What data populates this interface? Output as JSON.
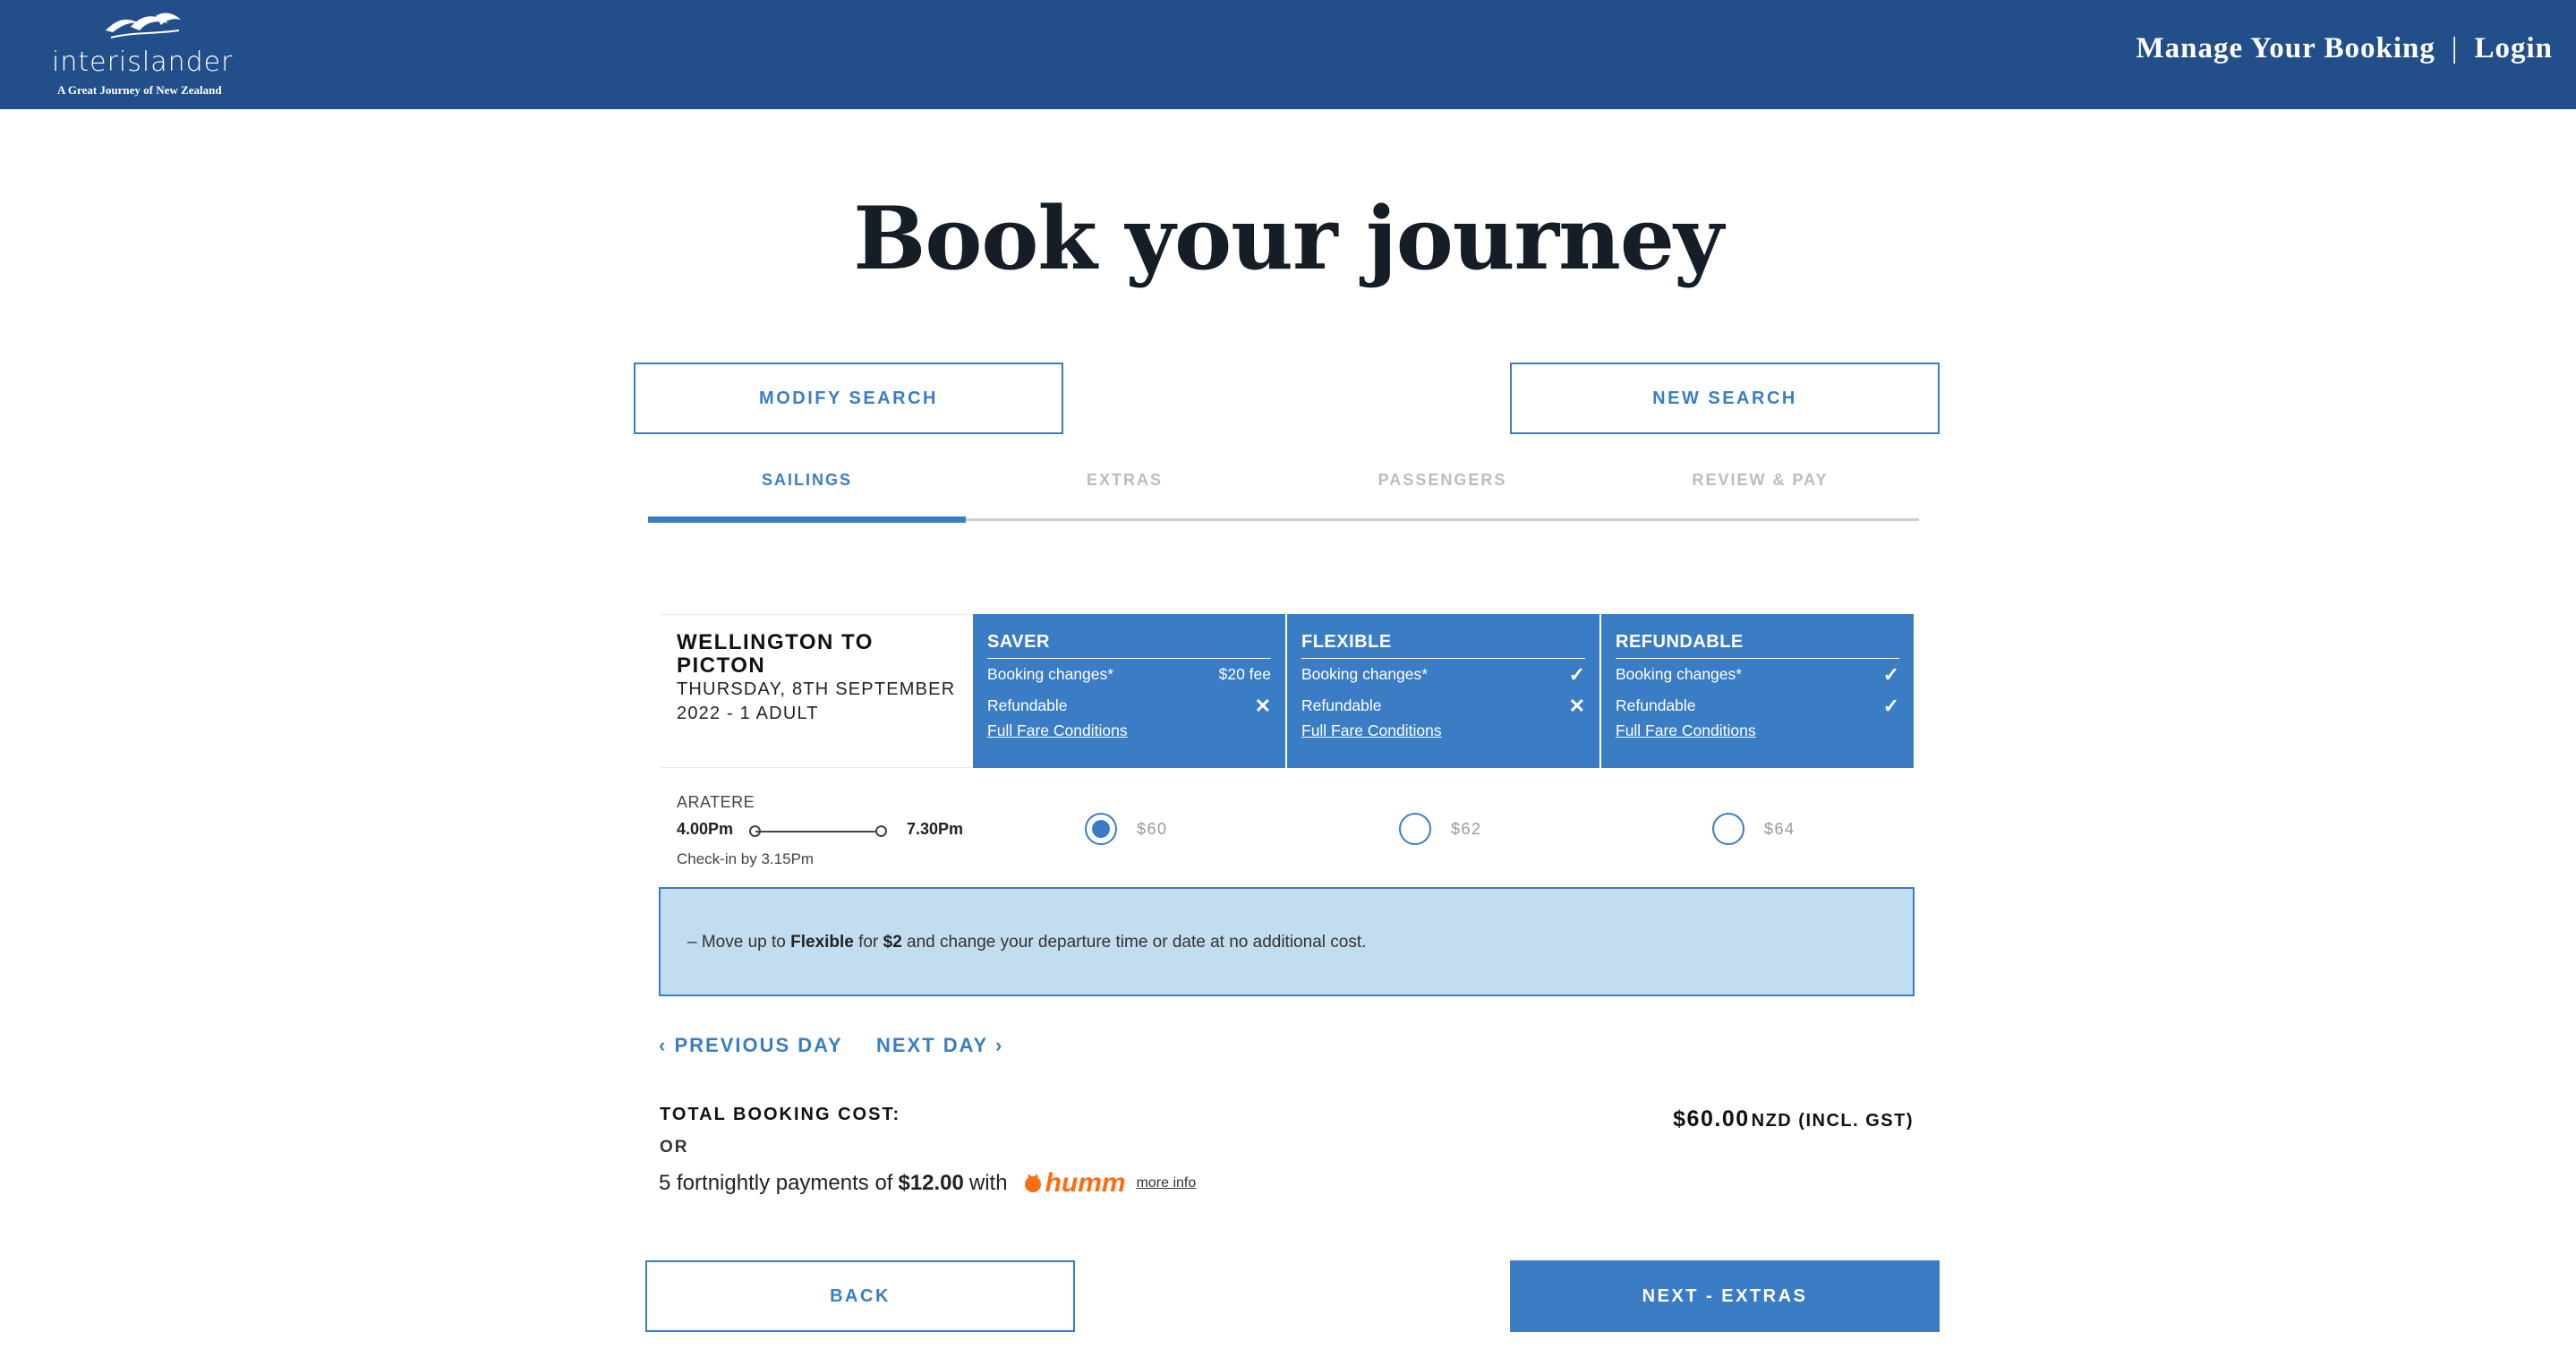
{
  "header": {
    "logo_text": "interislander",
    "logo_tagline": "A Great Journey of New Zealand",
    "manage_booking": "Manage Your Booking",
    "separator": "|",
    "login": "Login"
  },
  "page_title": "Book your journey",
  "buttons": {
    "modify_search": "MODIFY SEARCH",
    "new_search": "NEW SEARCH",
    "back": "BACK",
    "next": "NEXT - EXTRAS"
  },
  "steps": [
    {
      "label": "SAILINGS",
      "active": true
    },
    {
      "label": "EXTRAS",
      "active": false
    },
    {
      "label": "PASSENGERS",
      "active": false
    },
    {
      "label": "REVIEW & PAY",
      "active": false
    }
  ],
  "route": {
    "title": "WELLINGTON TO PICTON",
    "date": "THURSDAY, 8TH SEPTEMBER 2022 - 1 ADULT"
  },
  "fares": [
    {
      "name": "SAVER",
      "changes_label": "Booking changes*",
      "changes_value": "$20 fee",
      "refund_label": "Refundable",
      "refund_value": "✕",
      "link": "Full Fare Conditions"
    },
    {
      "name": "FLEXIBLE",
      "changes_label": "Booking changes*",
      "changes_value": "✓",
      "refund_label": "Refundable",
      "refund_value": "✕",
      "link": "Full Fare Conditions"
    },
    {
      "name": "REFUNDABLE",
      "changes_label": "Booking changes*",
      "changes_value": "✓",
      "refund_label": "Refundable",
      "refund_value": "✓",
      "link": "Full Fare Conditions"
    }
  ],
  "sailing": {
    "vessel": "ARATERE",
    "depart": "4.00Pm",
    "arrive": "7.30Pm",
    "checkin": "Check-in by 3.15Pm",
    "prices": [
      {
        "value": "$60",
        "selected": true
      },
      {
        "value": "$62",
        "selected": false
      },
      {
        "value": "$64",
        "selected": false
      }
    ]
  },
  "upsell": {
    "prefix": "– Move up to",
    "fare": "Flexible",
    "mid": "for",
    "amount": "$2",
    "suffix": "and change your departure time or date at no additional cost."
  },
  "daynav": {
    "prev": "PREVIOUS DAY",
    "next": "NEXT DAY"
  },
  "totals": {
    "label": "TOTAL BOOKING COST:",
    "or": "OR",
    "payments_prefix": "5 fortnightly payments of",
    "payments_amount": "$12.00",
    "payments_with": "with",
    "humm": "humm",
    "more_info": "more info",
    "amount": "$60.00",
    "currency": "NZD (INCL. GST)"
  },
  "colors": {
    "header_bg": "#224f8a",
    "accent": "#3b7dc4",
    "upsell_bg": "#c2dcf0",
    "humm": "#ff6c0f"
  }
}
